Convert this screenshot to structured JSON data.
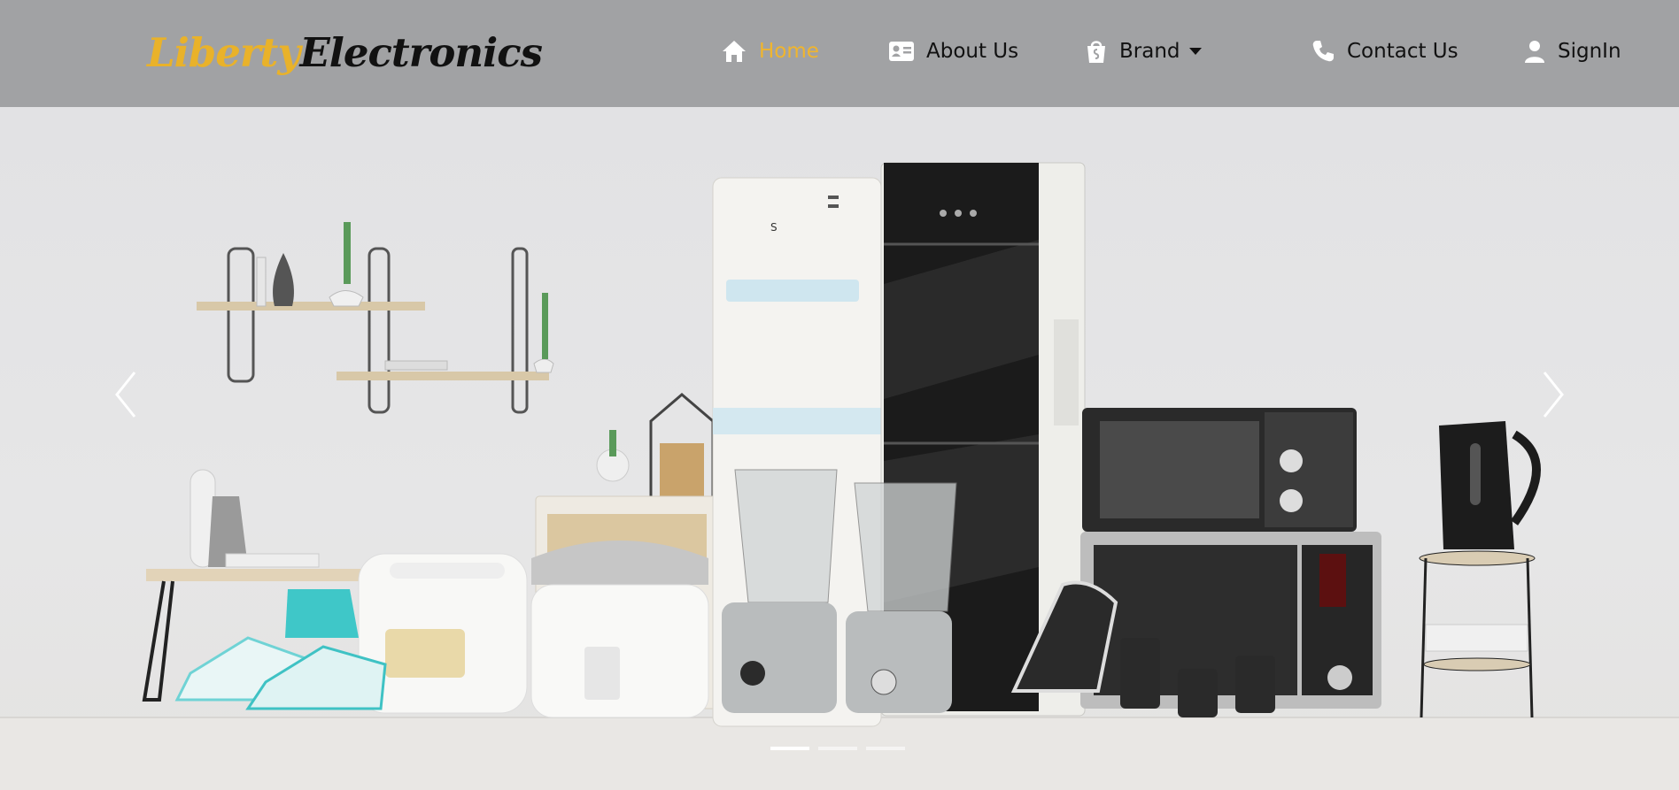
{
  "brand": {
    "logo_part1": "Liberty",
    "logo_part2": "Electronics"
  },
  "nav": {
    "home": "Home",
    "about": "About Us",
    "brand": "Brand",
    "contact": "Contact Us",
    "signin": "SignIn"
  },
  "colors": {
    "navbar_bg": "#a1a2a4",
    "accent": "#f0b52e",
    "text": "#111111"
  },
  "icons": {
    "home": "home-icon",
    "about": "id-card-icon",
    "brand": "shopping-bag-icon",
    "contact": "phone-icon",
    "signin": "user-icon",
    "prev": "chevron-left-icon",
    "next": "chevron-right-icon"
  },
  "carousel": {
    "slide_count": 3,
    "active_slide": 1
  }
}
